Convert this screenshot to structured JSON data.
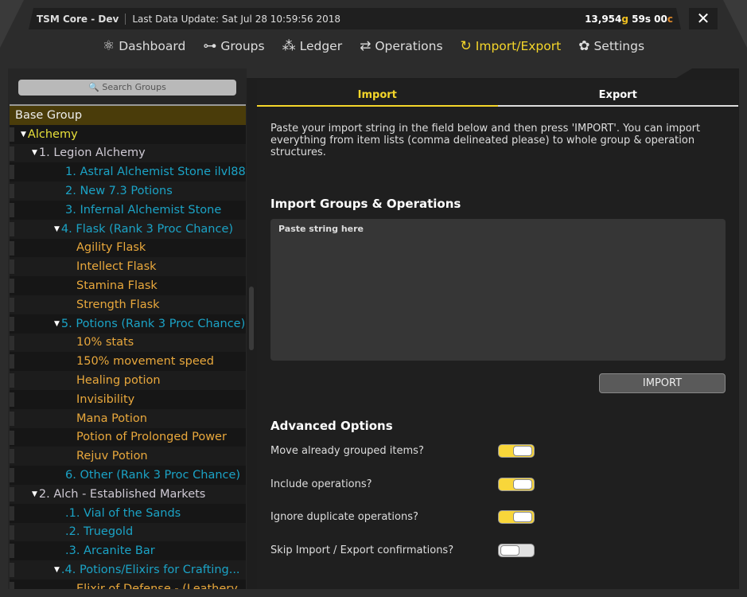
{
  "titlebar": {
    "app": "TSM Core - Dev",
    "last_update": "Last Data Update: Sat Jul 28 10:59:56 2018",
    "gold": "13,954",
    "gold_unit": "g",
    "silver": " 59s ",
    "copper": "00",
    "copper_unit": "c",
    "close": "✕"
  },
  "nav": [
    {
      "label": "Dashboard",
      "icon": "dashboard-icon",
      "glyph": "⚛"
    },
    {
      "label": "Groups",
      "icon": "groups-icon",
      "glyph": "⊶"
    },
    {
      "label": "Ledger",
      "icon": "ledger-icon",
      "glyph": "⁂"
    },
    {
      "label": "Operations",
      "icon": "operations-icon",
      "glyph": "⇄"
    },
    {
      "label": "Import/Export",
      "icon": "import-export-icon",
      "glyph": "↻",
      "active": true
    },
    {
      "label": "Settings",
      "icon": "settings-icon",
      "glyph": "✿"
    }
  ],
  "sidebar": {
    "search_placeholder": "🔍 Search Groups",
    "tree": [
      {
        "label": "Base Group",
        "level": 0
      },
      {
        "label": "Alchemy",
        "level": 1,
        "expanded": true
      },
      {
        "label": "1. Legion Alchemy",
        "level": 2,
        "expanded": true
      },
      {
        "label": "1. Astral Alchemist Stone ilvl88...",
        "level": 3
      },
      {
        "label": "2. New 7.3 Potions",
        "level": 3
      },
      {
        "label": "3. Infernal Alchemist Stone",
        "level": 3
      },
      {
        "label": "4. Flask (Rank 3 Proc Chance)",
        "level": 3,
        "expanded": true
      },
      {
        "label": "Agility Flask",
        "level": 4
      },
      {
        "label": "Intellect Flask",
        "level": 4
      },
      {
        "label": "Stamina Flask",
        "level": 4
      },
      {
        "label": "Strength Flask",
        "level": 4
      },
      {
        "label": "5. Potions (Rank 3 Proc Chance)",
        "level": 3,
        "expanded": true
      },
      {
        "label": "10% stats",
        "level": 4
      },
      {
        "label": "150% movement speed",
        "level": 4
      },
      {
        "label": "Healing potion",
        "level": 4
      },
      {
        "label": "Invisibility",
        "level": 4
      },
      {
        "label": "Mana Potion",
        "level": 4
      },
      {
        "label": "Potion of Prolonged Power",
        "level": 4
      },
      {
        "label": "Rejuv Potion",
        "level": 4
      },
      {
        "label": "6. Other (Rank 3 Proc Chance)",
        "level": 3
      },
      {
        "label": "2. Alch - Established Markets",
        "level": 2,
        "expanded": true
      },
      {
        "label": ".1. Vial of the Sands",
        "level": 3
      },
      {
        "label": ".2. Truegold",
        "level": 3
      },
      {
        "label": ".3. Arcanite Bar",
        "level": 3
      },
      {
        "label": ".4. Potions/Elixirs for Crafting...",
        "level": 3,
        "expanded": true
      },
      {
        "label": "Elixir of Defense - (Leathery",
        "level": 4
      }
    ]
  },
  "main": {
    "tabs": [
      {
        "label": "Import",
        "active": true
      },
      {
        "label": "Export"
      }
    ],
    "description": "Paste your import string in the field below and then press 'IMPORT'. You can import everything from item lists (comma delineated please) to whole group & operation structures.",
    "section_title": "Import Groups & Operations",
    "textarea_placeholder": "Paste string here",
    "textarea_value": "",
    "import_button": "IMPORT",
    "advanced_title": "Advanced Options",
    "options": [
      {
        "label": "Move already grouped items?",
        "on": true
      },
      {
        "label": "Include operations?",
        "on": true
      },
      {
        "label": "Ignore duplicate operations?",
        "on": true
      },
      {
        "label": "Skip Import / Export confirmations?",
        "on": false
      }
    ]
  },
  "colors": {
    "accent": "#f5d62a",
    "group": "#1ba3c6",
    "item": "#e9a83c"
  }
}
